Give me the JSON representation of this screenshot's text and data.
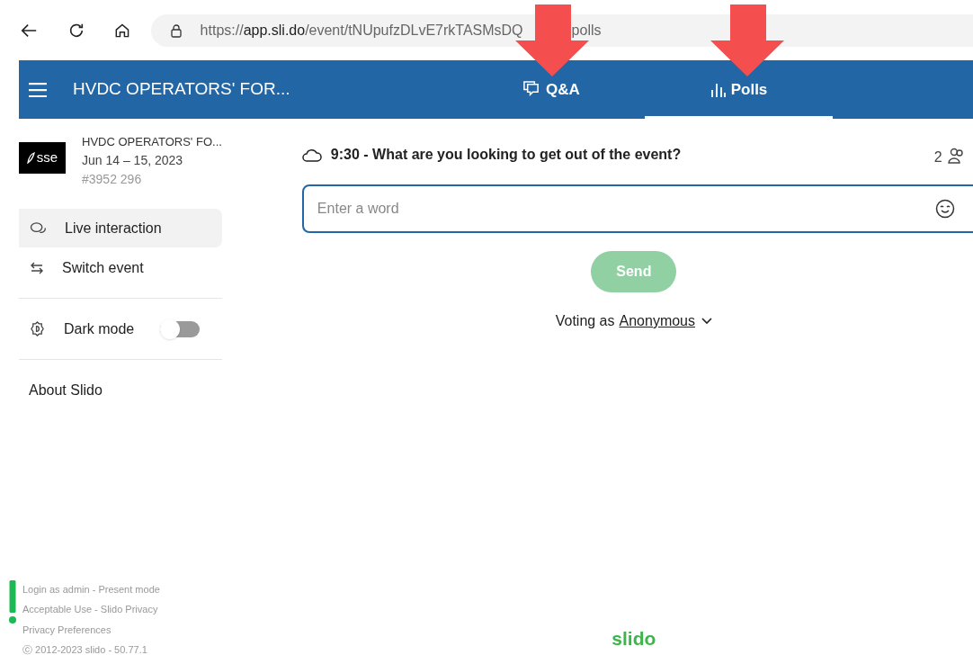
{
  "browser": {
    "url_start": "https://",
    "url_host": "app.sli.do",
    "url_path": "/event/tNUpufzDLvE7rkTASMsDQ",
    "url_end": "polls"
  },
  "header": {
    "title": "HVDC OPERATORS' FOR...",
    "tabs": [
      {
        "kind": "qa",
        "label": "Q&A",
        "selected": false
      },
      {
        "kind": "polls",
        "label": "Polls",
        "selected": true
      }
    ]
  },
  "sidebar": {
    "event": {
      "logo": "sse",
      "name": "HVDC OPERATORS' FO...",
      "dates": "Jun 14 – 15, 2023",
      "code": "#3952 296"
    },
    "items": [
      {
        "kind": "live",
        "label": "Live interaction",
        "selected": true
      },
      {
        "kind": "switch",
        "label": "Switch event",
        "selected": false
      }
    ],
    "dark_mode": {
      "label": "Dark mode",
      "on": false
    },
    "about": "About Slido",
    "footer": [
      "Login as admin - Present mode",
      "Acceptable Use - Slido Privacy",
      "Privacy Preferences",
      "ⓒ 2012-2023 slido - 50.77.1"
    ]
  },
  "poll": {
    "title": "9:30 - What are you looking to get out of the event?",
    "participants": "2",
    "input": {
      "placeholder": "Enter a word"
    },
    "send": "Send",
    "voting_as": "Voting as",
    "voter": "Anonymous"
  },
  "brand": "slido"
}
